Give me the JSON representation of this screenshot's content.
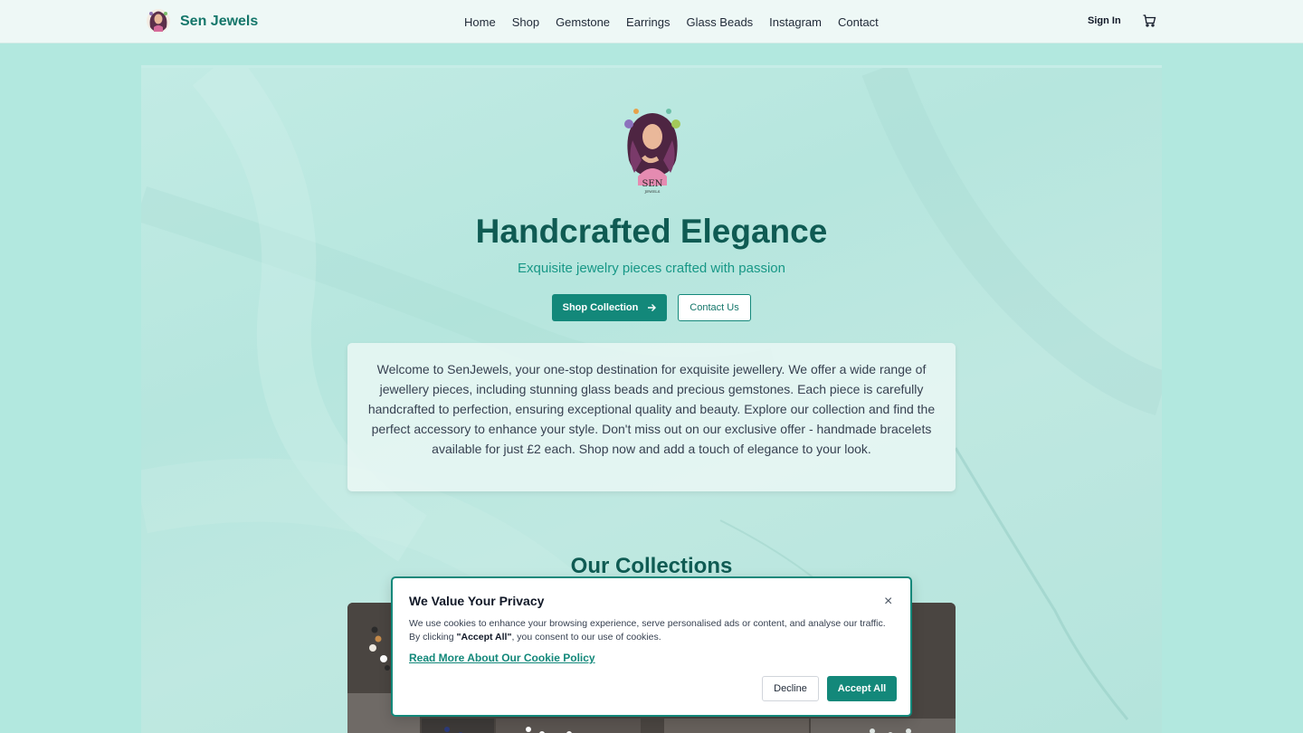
{
  "header": {
    "brand": "Sen Jewels",
    "nav": [
      "Home",
      "Shop",
      "Gemstone",
      "Earrings",
      "Glass Beads",
      "Instagram",
      "Contact"
    ],
    "sign_in": "Sign In"
  },
  "hero": {
    "logo_text": "SEN",
    "logo_subtext": "JEWELS",
    "title": "Handcrafted Elegance",
    "subtitle": "Exquisite jewelry pieces crafted with passion",
    "primary_button": "Shop Collection",
    "secondary_button": "Contact Us",
    "intro": "Welcome to SenJewels, your one-stop destination for exquisite jewellery. We offer a wide range of jewellery pieces, including stunning glass beads and precious gemstones. Each piece is carefully handcrafted to perfection, ensuring exceptional quality and beauty. Explore our collection and find the perfect accessory to enhance your style. Don't miss out on our exclusive offer - handmade bracelets available for just £2 each. Shop now and add a touch of elegance to your look."
  },
  "collections": {
    "title": "Our Collections"
  },
  "cookie_banner": {
    "title": "We Value Your Privacy",
    "close": "×",
    "text_before": "We use cookies to enhance your browsing experience, serve personalised ads or content, and analyse our traffic. By clicking ",
    "text_bold": "\"Accept All\"",
    "text_after": ", you consent to our use of cookies.",
    "link": "Read More About Our Cookie Policy",
    "decline": "Decline",
    "accept": "Accept All"
  },
  "colors": {
    "brand_teal": "#13887a",
    "dark_teal": "#0f5b53",
    "page_background": "#b2e8df"
  },
  "icons": [
    "brand-logo",
    "cart-icon",
    "arrow-right-icon",
    "close-icon"
  ]
}
